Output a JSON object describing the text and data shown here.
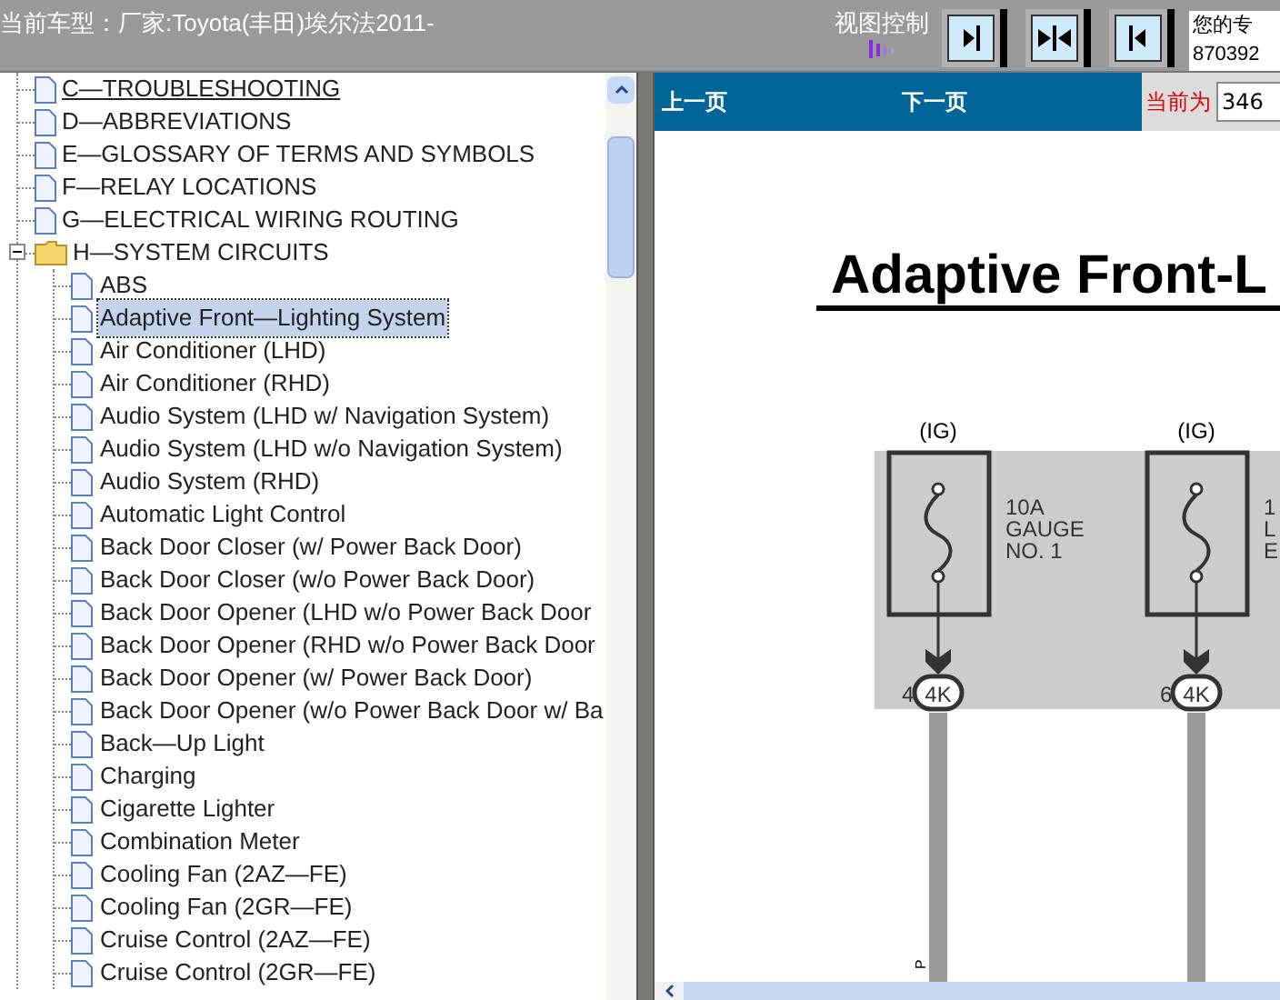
{
  "header": {
    "title": "当前车型：厂家:Toyota(丰田)埃尔法2011-",
    "view_control_label": "视图控制",
    "view_buttons": [
      {
        "kind": "right"
      },
      {
        "kind": "split"
      },
      {
        "kind": "left"
      }
    ],
    "notice_lines": [
      "您的专",
      "870392"
    ]
  },
  "tree": {
    "items": [
      {
        "label": "C—TROUBLESHOOTING",
        "kind": "page",
        "hover": true
      },
      {
        "label": "D—ABBREVIATIONS",
        "kind": "page",
        "hover": false
      },
      {
        "label": "E—GLOSSARY OF TERMS AND SYMBOLS",
        "kind": "page",
        "hover": false
      },
      {
        "label": "F—RELAY LOCATIONS",
        "kind": "page",
        "hover": false
      },
      {
        "label": "G—ELECTRICAL WIRING ROUTING",
        "kind": "page",
        "hover": false
      },
      {
        "label": "H—SYSTEM CIRCUITS",
        "kind": "folder",
        "hover": false,
        "expanded": true,
        "children": [
          {
            "label": "ABS",
            "selected": false
          },
          {
            "label": "Adaptive Front—Lighting System",
            "selected": true
          },
          {
            "label": "Air Conditioner (LHD)",
            "selected": false
          },
          {
            "label": "Air Conditioner (RHD)",
            "selected": false
          },
          {
            "label": "Audio System (LHD w/ Navigation System)",
            "selected": false
          },
          {
            "label": "Audio System (LHD w/o Navigation System)",
            "selected": false
          },
          {
            "label": "Audio System (RHD)",
            "selected": false
          },
          {
            "label": "Automatic Light Control",
            "selected": false
          },
          {
            "label": "Back Door Closer (w/ Power Back Door)",
            "selected": false
          },
          {
            "label": "Back Door Closer (w/o Power Back Door)",
            "selected": false
          },
          {
            "label": "Back Door Opener (LHD w/o Power Back Door",
            "selected": false
          },
          {
            "label": "Back Door Opener (RHD w/o Power Back Door",
            "selected": false
          },
          {
            "label": "Back Door Opener (w/ Power Back Door)",
            "selected": false
          },
          {
            "label": "Back Door Opener (w/o Power Back Door w/ Ba",
            "selected": false
          },
          {
            "label": "Back—Up Light",
            "selected": false
          },
          {
            "label": "Charging",
            "selected": false
          },
          {
            "label": "Cigarette Lighter",
            "selected": false
          },
          {
            "label": "Combination Meter",
            "selected": false
          },
          {
            "label": "Cooling Fan (2AZ—FE)",
            "selected": false
          },
          {
            "label": "Cooling Fan (2GR—FE)",
            "selected": false
          },
          {
            "label": "Cruise Control (2AZ—FE)",
            "selected": false
          },
          {
            "label": "Cruise Control (2GR—FE)",
            "selected": false
          }
        ]
      }
    ]
  },
  "nav": {
    "prev": "上一页",
    "next": "下一页",
    "current_label": "当前为",
    "current_page": "346"
  },
  "diagram": {
    "title": "Adaptive Front-L",
    "fuses": [
      {
        "source": "(IG)",
        "label_lines": [
          "10A",
          "GAUGE",
          "NO. 1"
        ],
        "pin": "4",
        "connector": "4K"
      },
      {
        "source": "(IG)",
        "label_lines": [
          "1",
          "L",
          "E"
        ],
        "pin": "6",
        "connector": "4K"
      }
    ],
    "wire_mark": "P"
  }
}
